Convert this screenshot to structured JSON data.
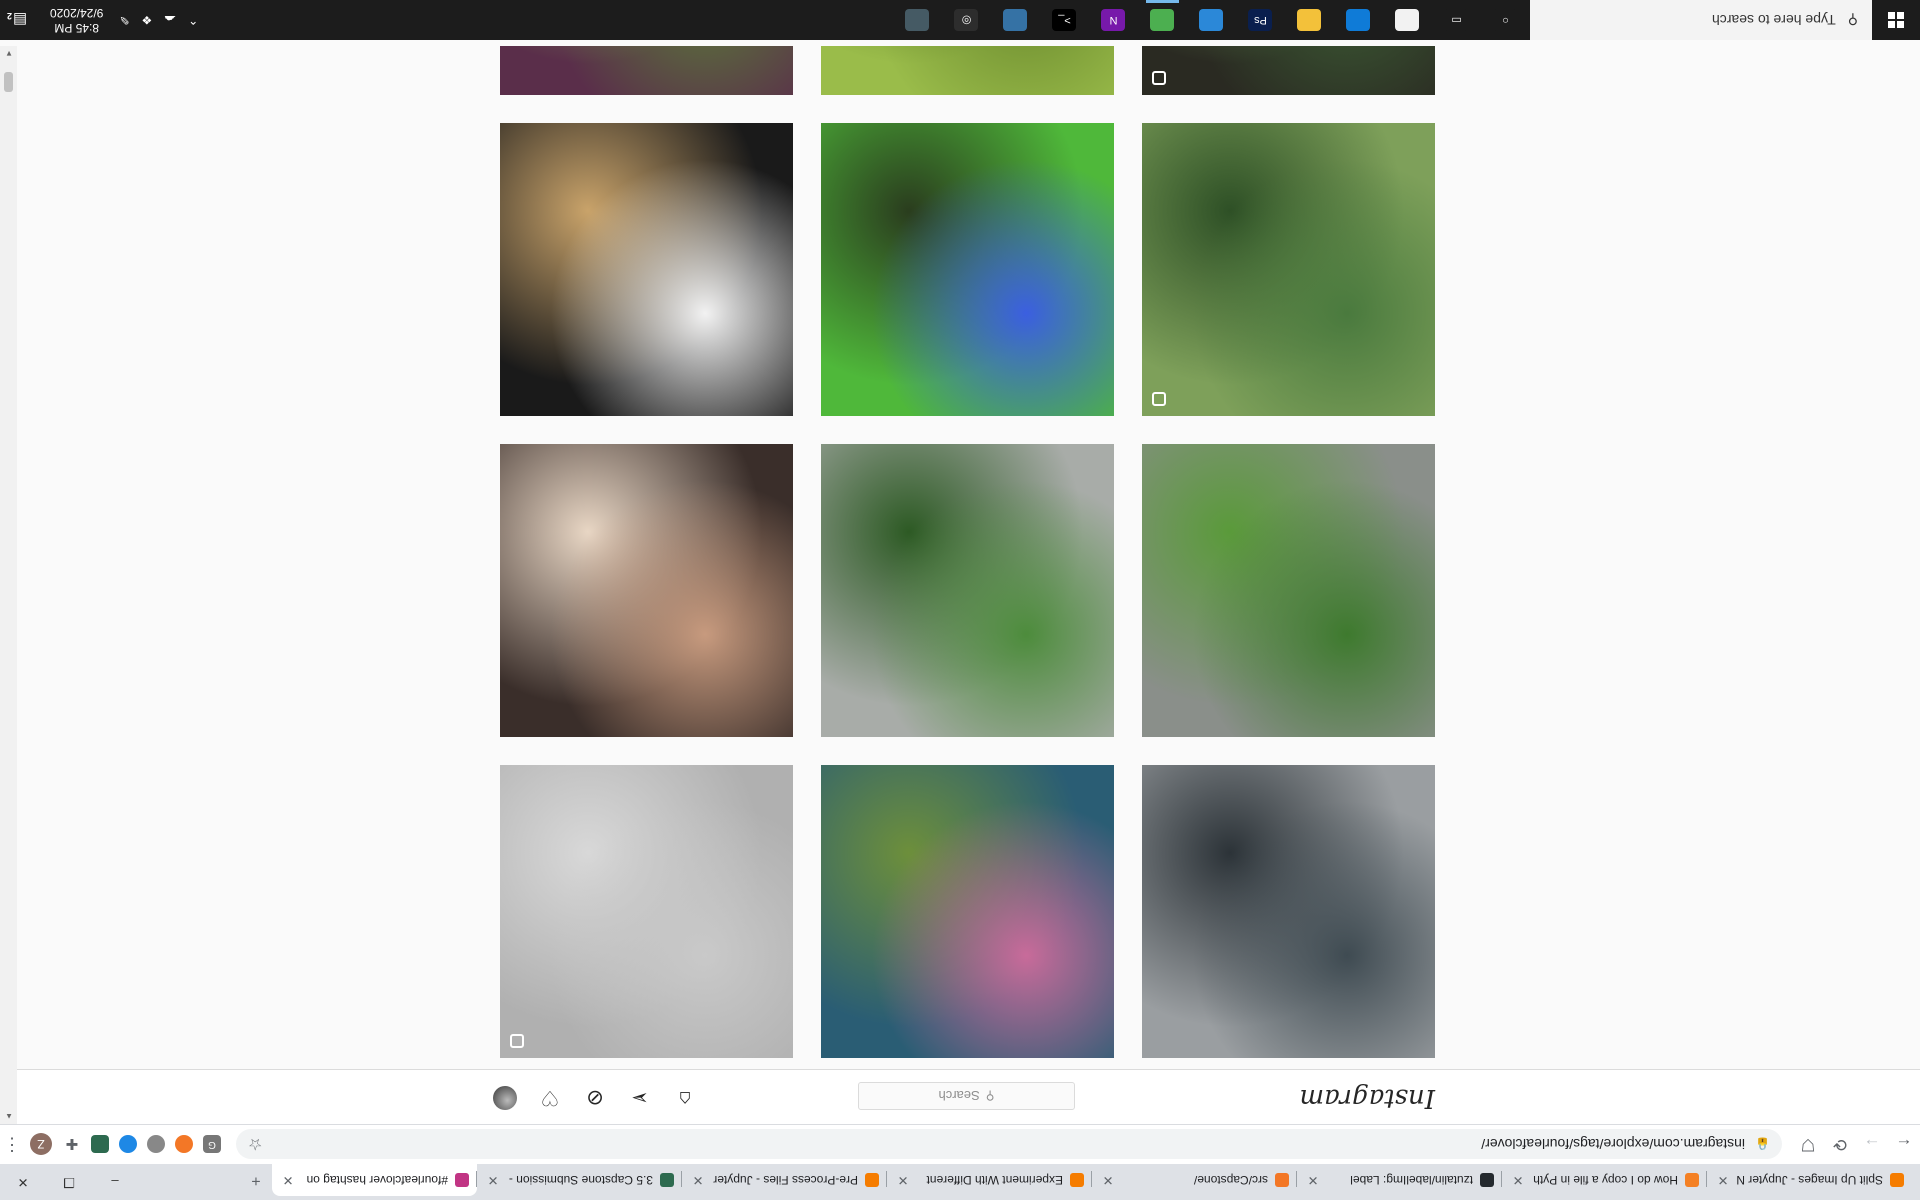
{
  "browser": {
    "tabs": [
      {
        "title": "Split Up Images - Jupyter N",
        "color": "#f57c00"
      },
      {
        "title": "How do I copy a file in Pyth",
        "color": "#f48024"
      },
      {
        "title": "tzutalin/labelImg: Label",
        "color": "#24292e"
      },
      {
        "title": "src/Capstone/",
        "color": "#f37726"
      },
      {
        "title": "Experiment With Different",
        "color": "#f57c00"
      },
      {
        "title": "Pre-Process Files - Jupyter",
        "color": "#f57c00"
      },
      {
        "title": "3.5 Capstone Submission -",
        "color": "#2d6a4f"
      },
      {
        "title": "#fourleafclover hashtag on",
        "color": "#c13584",
        "active": true
      }
    ],
    "newtab_symbol": "+",
    "window_controls": {
      "minimize": "–",
      "restore": "❐",
      "close": "✕"
    },
    "nav": {
      "back": "←",
      "forward": "→",
      "reload": "⟳"
    },
    "url": "instagram.com/explore/tags/fourleafclover/",
    "profile_initial": "Z"
  },
  "instagram": {
    "logo": "Instagram",
    "search_placeholder": "Search",
    "tiles": [
      {
        "colors": [
          "#3f4b52",
          "#9a9ea1",
          "#2c3338"
        ],
        "multi": false
      },
      {
        "colors": [
          "#c86b9a",
          "#2a5d74",
          "#6d8f3b"
        ],
        "multi": false
      },
      {
        "colors": [
          "#c9c9c9",
          "#b0b0b0",
          "#d8d8d8"
        ],
        "multi": true
      },
      {
        "colors": [
          "#3e7a2e",
          "#8a8f8a",
          "#5a9a3a"
        ],
        "multi": false
      },
      {
        "colors": [
          "#4d8c3c",
          "#a8aca8",
          "#2d5a24"
        ],
        "multi": false
      },
      {
        "colors": [
          "#c79a7e",
          "#3a2e2a",
          "#e8d6c4"
        ],
        "multi": false
      },
      {
        "colors": [
          "#4a7a3e",
          "#7ea05a",
          "#2e5026"
        ],
        "multi": true
      },
      {
        "colors": [
          "#3b5fe0",
          "#4fb83a",
          "#2a3d1e"
        ],
        "multi": false
      },
      {
        "colors": [
          "#f2f2f2",
          "#1a1a1a",
          "#c9a36a"
        ],
        "multi": false
      },
      {
        "colors": [
          "#3c5a34",
          "#2a2a22",
          "#6e9a58"
        ],
        "multi": true
      },
      {
        "colors": [
          "#6b8a2e",
          "#9abc4a",
          "#4a6a1e"
        ],
        "multi": false
      },
      {
        "colors": [
          "#5a7a3a",
          "#5a2e4a",
          "#8ab85a"
        ],
        "multi": false
      }
    ]
  },
  "taskbar": {
    "search_placeholder": "Type here to search",
    "apps": [
      {
        "name": "cortana",
        "color": "#1c1c1c",
        "glyph": "○"
      },
      {
        "name": "task-view",
        "color": "#1c1c1c",
        "glyph": "▭"
      },
      {
        "name": "microsoft-store",
        "color": "#f2f2f2",
        "glyph": ""
      },
      {
        "name": "edge",
        "color": "#0f7bd7",
        "glyph": ""
      },
      {
        "name": "file-explorer",
        "color": "#f3c13a",
        "glyph": ""
      },
      {
        "name": "photoshop",
        "color": "#0a1f4e",
        "glyph": "Ps"
      },
      {
        "name": "photos",
        "color": "#2b88d8",
        "glyph": ""
      },
      {
        "name": "chrome",
        "color": "#4caf50",
        "glyph": ""
      },
      {
        "name": "onenote",
        "color": "#7719aa",
        "glyph": "N"
      },
      {
        "name": "terminal",
        "color": "#000000",
        "glyph": ">_"
      },
      {
        "name": "python",
        "color": "#3572a5",
        "glyph": ""
      },
      {
        "name": "jupyter",
        "color": "#2d2d2d",
        "glyph": "◎"
      },
      {
        "name": "calculator",
        "color": "#455a64",
        "glyph": ""
      }
    ],
    "time": "8:45 PM",
    "date": "9/24/2020",
    "notification_count": "2"
  }
}
